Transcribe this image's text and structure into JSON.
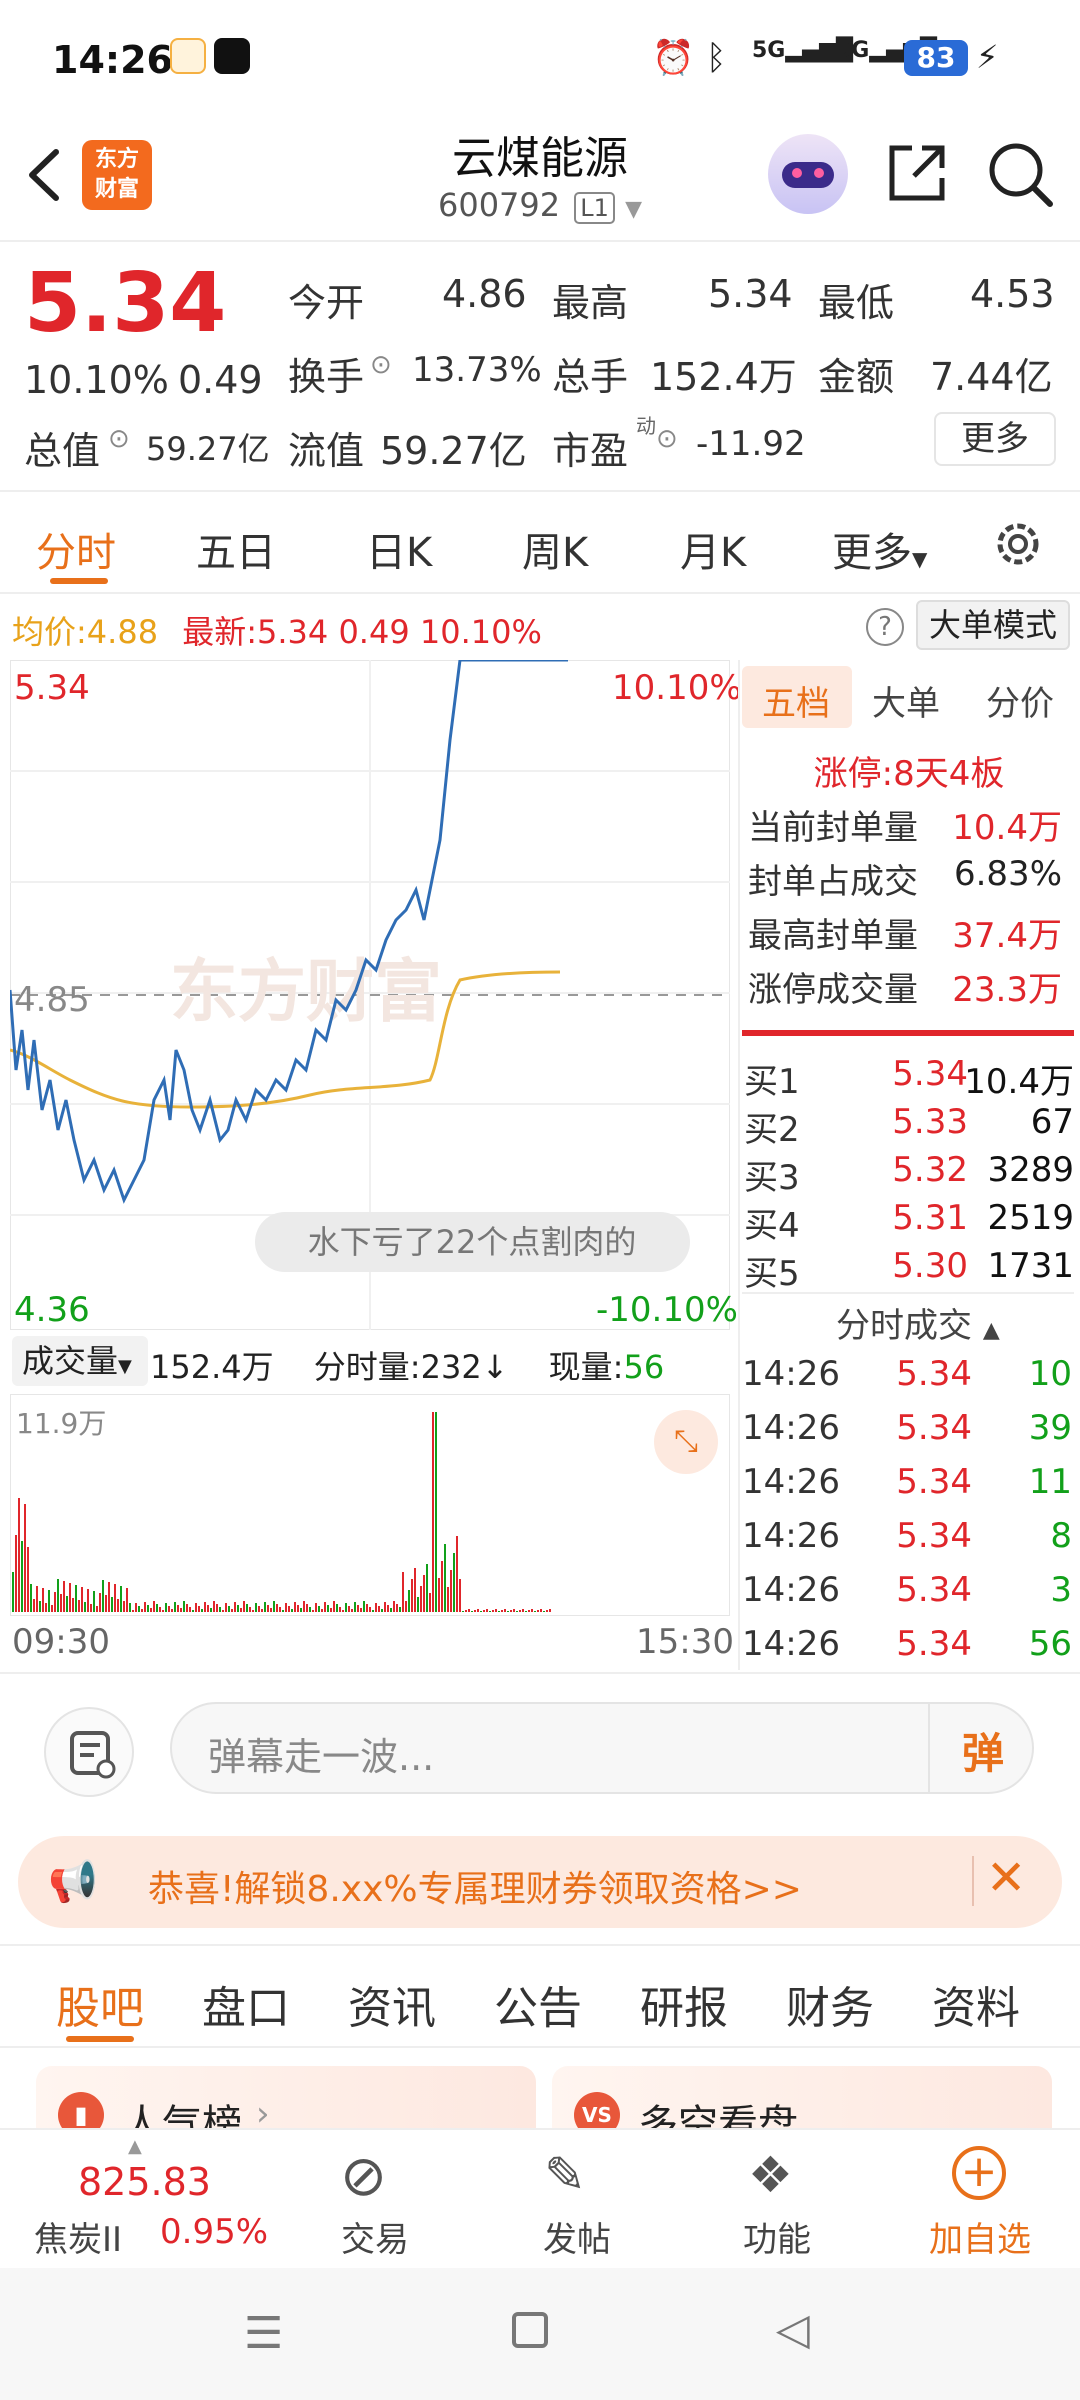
{
  "status_bar": {
    "time": "14:26",
    "battery": "83",
    "network1": "5G",
    "network2": "5G"
  },
  "header": {
    "title": "云煤能源",
    "code": "600792",
    "level_badge": "L1",
    "logo_line1": "东方",
    "logo_line2": "财富"
  },
  "quote": {
    "price": "5.34",
    "change_pct": "10.10%",
    "change": "0.49",
    "open_label": "今开",
    "open": "4.86",
    "high_label": "最高",
    "high": "5.34",
    "low_label": "最低",
    "low": "4.53",
    "turnover_label": "换手",
    "turnover": "13.73%",
    "volume_label": "总手",
    "volume": "152.4万",
    "amount_label": "金额",
    "amount": "7.44亿",
    "mktcap_label": "总值",
    "mktcap": "59.27亿",
    "float_label": "流值",
    "float_cap": "59.27亿",
    "pe_label": "市盈",
    "pe_sup": "动",
    "pe": "-11.92",
    "more": "更多"
  },
  "chart_tabs": [
    "分时",
    "五日",
    "日K",
    "周K",
    "月K",
    "更多"
  ],
  "info_line": {
    "avg_label": "均价:",
    "avg": "4.88",
    "latest_label": "最新:",
    "latest": "5.34",
    "latest_change": "0.49",
    "latest_pct": "10.10%",
    "big_order_mode": "大单模式"
  },
  "intraday": {
    "y_top": "5.34",
    "y_mid": "4.85",
    "y_bottom": "4.36",
    "pct_top": "10.10%",
    "pct_bottom": "-10.10%",
    "watermark": "东方财富",
    "danmaku": "水下亏了22个点割肉的"
  },
  "volume_panel": {
    "selector": "成交量",
    "total": "152.4万",
    "per_min_label": "分时量:",
    "per_min": "232",
    "current_label": "现量:",
    "current": "56",
    "max_label": "11.9万",
    "t_start": "09:30",
    "t_end": "15:30"
  },
  "right_panel": {
    "tabs": [
      "五档",
      "大单",
      "分价"
    ],
    "limit_up": "涨停:8天4板",
    "rows": [
      {
        "label": "当前封单量",
        "value": "10.4万"
      },
      {
        "label": "封单占成交",
        "value": "6.83%"
      },
      {
        "label": "最高封单量",
        "value": "37.4万"
      },
      {
        "label": "涨停成交量",
        "value": "23.3万"
      }
    ],
    "bids": [
      {
        "label": "买1",
        "price": "5.34",
        "vol": "10.4万"
      },
      {
        "label": "买2",
        "price": "5.33",
        "vol": "67"
      },
      {
        "label": "买3",
        "price": "5.32",
        "vol": "3289"
      },
      {
        "label": "买4",
        "price": "5.31",
        "vol": "2519"
      },
      {
        "label": "买5",
        "price": "5.30",
        "vol": "1731"
      }
    ],
    "ticks_header": "分时成交",
    "ticks": [
      {
        "time": "14:26",
        "price": "5.34",
        "vol": "10"
      },
      {
        "time": "14:26",
        "price": "5.34",
        "vol": "39"
      },
      {
        "time": "14:26",
        "price": "5.34",
        "vol": "11"
      },
      {
        "time": "14:26",
        "price": "5.34",
        "vol": "8"
      },
      {
        "time": "14:26",
        "price": "5.34",
        "vol": "3"
      },
      {
        "time": "14:26",
        "price": "5.34",
        "vol": "56"
      }
    ]
  },
  "comment_bar": {
    "placeholder": "弹幕走一波...",
    "danmaku_btn": "弹"
  },
  "promo": {
    "text": "恭喜!解锁8.xx%专属理财券领取资格>>"
  },
  "lower_tabs": [
    "股吧",
    "盘口",
    "资讯",
    "公告",
    "研报",
    "财务",
    "资料"
  ],
  "cards": [
    {
      "title": "人气榜"
    },
    {
      "title": "多空看盘",
      "badge": "VS"
    }
  ],
  "bottom_nav": {
    "ticker_value": "825.83",
    "ticker_name": "焦炭II",
    "ticker_pct": "0.95%",
    "items": [
      "交易",
      "发帖",
      "功能",
      "加自选"
    ]
  },
  "colors": {
    "accent": "#e8701a",
    "up": "#e0262b",
    "down": "#12a01a",
    "price_line": "#2f6db5",
    "avg_line": "#e8b23a"
  }
}
